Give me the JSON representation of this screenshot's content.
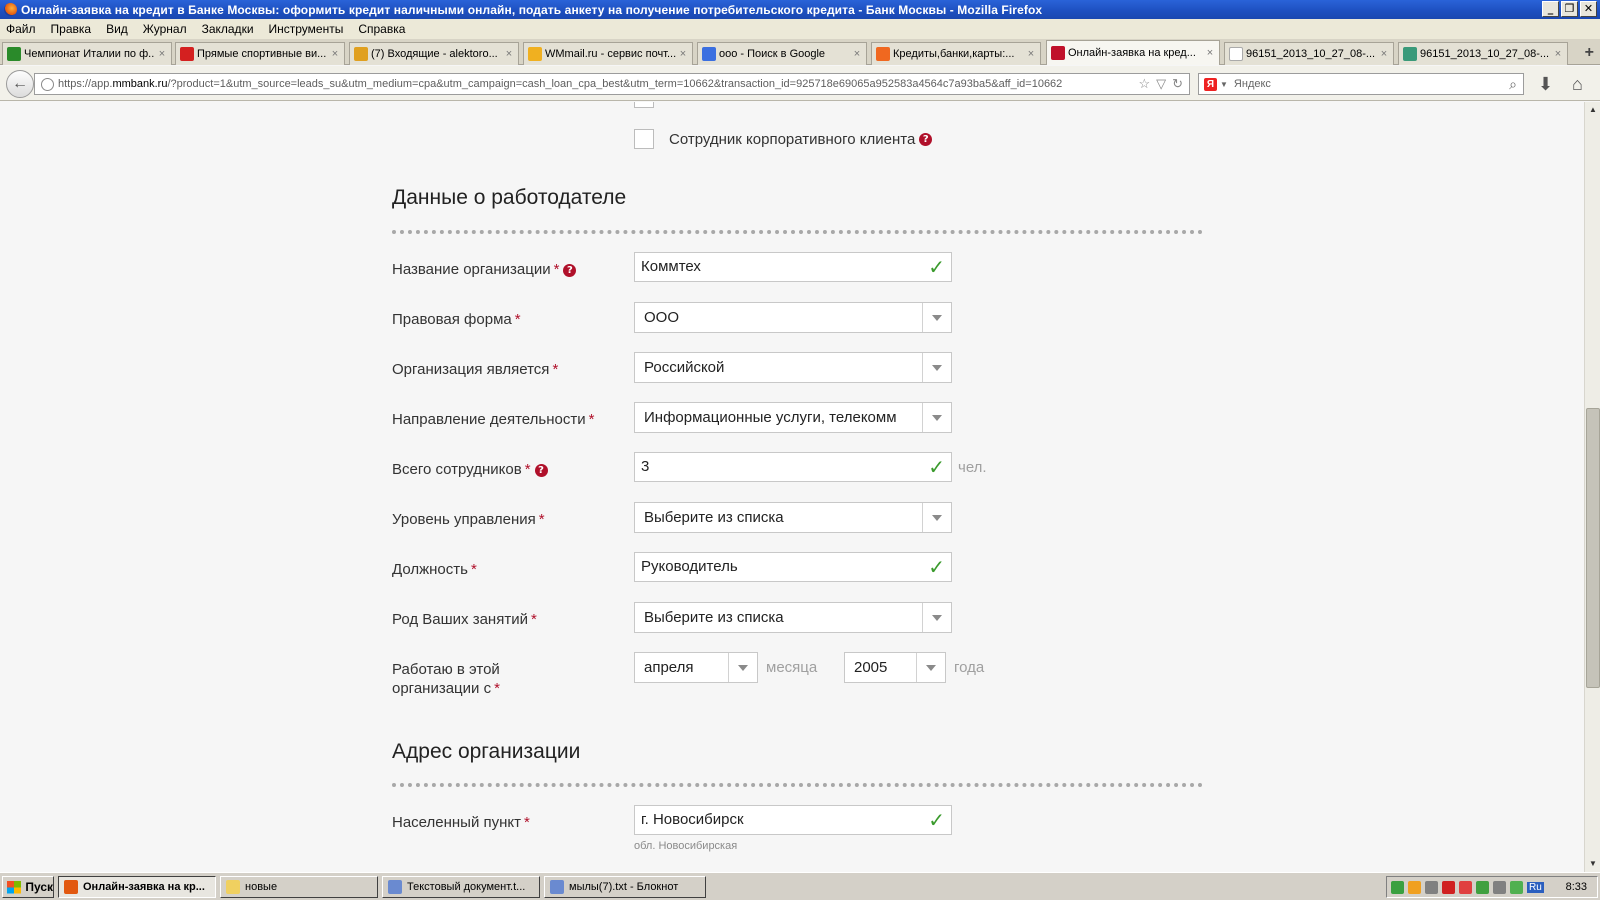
{
  "window": {
    "title": "Онлайн-заявка на кредит в Банке Москвы: оформить кредит наличными онлайн, подать анкету на получение потребительского кредита - Банк Москвы - Mozilla Firefox",
    "minimize": "_",
    "maximize": "❐",
    "close": "✕"
  },
  "menubar": [
    "Файл",
    "Правка",
    "Вид",
    "Журнал",
    "Закладки",
    "Инструменты",
    "Справка"
  ],
  "tabs": [
    {
      "label": "Чемпионат Италии по ф...",
      "icon_color": "#2a8a2a"
    },
    {
      "label": "Прямые спортивные ви...",
      "icon_color": "#d42020"
    },
    {
      "label": "(7) Входящие - alektoro...",
      "icon_color": "#e0a020"
    },
    {
      "label": "WMmail.ru - сервис почт...",
      "icon_color": "#f0b020"
    },
    {
      "label": "ooo - Поиск в Google",
      "icon_color": "#3b6fe0"
    },
    {
      "label": "Кредиты,банки,карты:...",
      "icon_color": "#f06820"
    },
    {
      "label": "Онлайн-заявка на кред...",
      "icon_color": "#c0102a"
    },
    {
      "label": "96151_2013_10_27_08-...",
      "icon_color": "#ffffff"
    },
    {
      "label": "96151_2013_10_27_08-...",
      "icon_color": "#3a9a7a"
    }
  ],
  "tab_close": "×",
  "new_tab": "+",
  "navbar": {
    "back": "←",
    "url_prefix": "https://app.",
    "url_domain": "mmbank.ru",
    "url_rest": "/?product=1&utm_source=leads_su&utm_medium=cpa&utm_campaign=cash_loan_cpa_best&utm_term=10662&transaction_id=925718e69065a952583a4564c7a93ba5&aff_id=10662",
    "star": "☆",
    "dropdown": "▽",
    "reload": "↻",
    "search_engine": "Я",
    "search_placeholder": "Яндекс",
    "search_icon": "⌕",
    "download": "⬇",
    "home": "⌂"
  },
  "form": {
    "corporate_client_label": "Сотрудник корпоративного клиента",
    "employer_section_title": "Данные о работодателе",
    "address_section_title": "Адрес организации",
    "help_mark": "?",
    "required_mark": "*",
    "check_mark": "✓",
    "fields": {
      "org_name": {
        "label": "Название организации",
        "value": "Коммтех"
      },
      "legal_form": {
        "label": "Правовая форма",
        "value": "ООО"
      },
      "org_type": {
        "label": "Организация является",
        "value": "Российской"
      },
      "activity": {
        "label": "Направление деятельности",
        "value": "Информационные услуги, телекомм"
      },
      "employees": {
        "label": "Всего сотрудников",
        "value": "3",
        "unit": "чел."
      },
      "management_level": {
        "label": "Уровень управления",
        "value": "Выберите из списка"
      },
      "position": {
        "label": "Должность",
        "value": "Руководитель"
      },
      "occupation": {
        "label": "Род Ваших занятий",
        "value": "Выберите из списка"
      },
      "work_since": {
        "label_line1": "Работаю в этой",
        "label_line2": "организации с",
        "month": "апреля",
        "month_unit": "месяца",
        "year": "2005",
        "year_unit": "года"
      },
      "city": {
        "label": "Населенный пункт",
        "value": "г. Новосибирск",
        "hint": "обл. Новосибирская"
      }
    }
  },
  "taskbar": {
    "start": "Пуск",
    "tasks": [
      {
        "label": "Онлайн-заявка на кр...",
        "icon_color": "#e2580f",
        "active": true
      },
      {
        "label": "новые",
        "icon_color": "#f0d060",
        "active": false
      },
      {
        "label": "Текстовый документ.t...",
        "icon_color": "#6a8ad0",
        "active": false
      },
      {
        "label": "мылы(7).txt - Блокнот",
        "icon_color": "#6a8ad0",
        "active": false
      }
    ],
    "tray_icons": [
      "#3aa040",
      "#f0a020",
      "#808080",
      "#d02020",
      "#e04040",
      "#40a040",
      "#808080",
      "#50b050"
    ],
    "lang": "Ru",
    "clock": "8:33"
  }
}
